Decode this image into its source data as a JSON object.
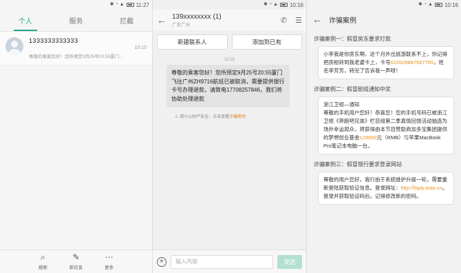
{
  "screen1": {
    "status": {
      "time": "11:27"
    },
    "tabs": [
      "个人",
      "服务",
      "拦截"
    ],
    "conversation": {
      "name": "1333333333333",
      "preview": "尊敬的乘客您好！您所预定9月25号20:55厦门...",
      "time": "10:15"
    },
    "bottom": [
      {
        "icon": "search-icon",
        "label": "搜索"
      },
      {
        "icon": "compose-icon",
        "label": "新信息"
      },
      {
        "icon": "more-icon",
        "label": "更多"
      }
    ]
  },
  "screen2": {
    "status": {
      "time": "10:16"
    },
    "header": {
      "number": "139xxxxxxxx (1)",
      "location": "广东广州"
    },
    "buttons": {
      "new_contact": "新建联系人",
      "add_existing": "添加到已有"
    },
    "msg_time": "10:15",
    "message": "尊敬的乘客您好！您所预定9月25号20:55厦门飞往广州ZH9716航班已被取消，需要提供银行卡号办理退款，请致电17708257846，我们将协助处理退款",
    "warning": {
      "text": "请小心财产安全，点击查看",
      "link": "诈骗案例"
    },
    "input_placeholder": "输入内容",
    "send_label": "发送"
  },
  "screen3": {
    "status": {
      "time": "10:16"
    },
    "title": "诈骗案例",
    "cases": [
      {
        "title": "诈骗案例一：假冒房东要求打款",
        "text_before": "小李我是你房东啊，这个月外出旅游联系不上，你记得把房租转到我老婆卡上，卡号",
        "highlight": "6226288675877​65",
        "text_after": "，姓名李芳芳，转完了告诉我一声呀！"
      },
      {
        "title": "诈骗案例二：假冒剧组通知中奖",
        "line1": "浙江卫视—通知",
        "text_before": "尊敬的手机用户您好！恭喜您！您的手机号码已被浙江卫视《奔跑吧兄弟》栏目组第二季真情回馈活动抽选为场外幸运观众，将获得由本节目赞助商加多宝集团提供的梦想创业基金",
        "highlight": "128000",
        "text_after": "元（RMB）与苹果MacBook Pro笔记本电脑一台。"
      },
      {
        "title": "诈骗案例三：假冒银行要求登录网站",
        "text_before": "尊敬的用户您好，我行由于系统维护升级一轮，需要重新登陆获取验证信息。登录网址：",
        "highlight": "http://hiply.toda.cn",
        "text_after": "。登录并获取验证码后，记得修改新的密码。"
      }
    ]
  },
  "colors": {
    "accent": "#27a58a",
    "link": "#e8901e",
    "send_disabled": "#b4e0cf"
  }
}
